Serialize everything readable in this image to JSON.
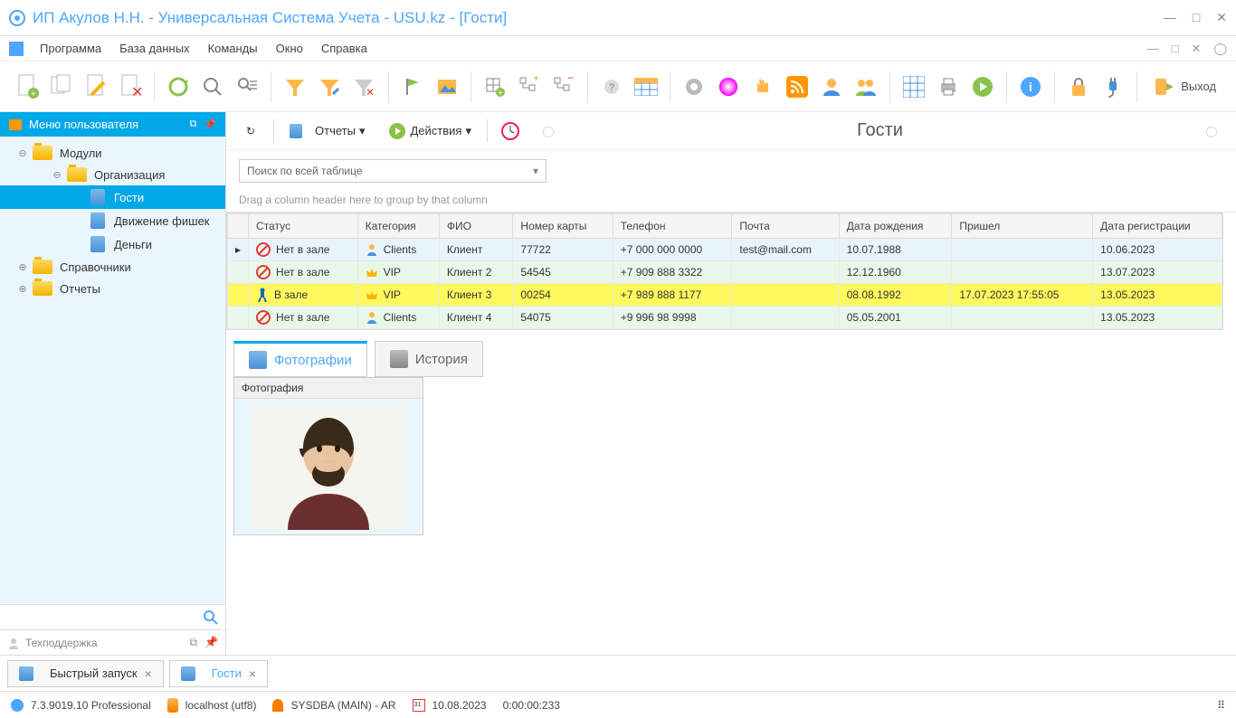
{
  "window": {
    "title": "ИП Акулов Н.Н. - Универсальная Система Учета - USU.kz - [Гости]"
  },
  "menubar": {
    "items": [
      "Программа",
      "База данных",
      "Команды",
      "Окно",
      "Справка"
    ]
  },
  "toolbar": {
    "exit_label": "Выход"
  },
  "sidebar": {
    "header": "Меню пользователя",
    "tree": {
      "modules": "Модули",
      "organization": "Организация",
      "guests": "Гости",
      "chips": "Движение фишек",
      "money": "Деньги",
      "refs": "Справочники",
      "reports": "Отчеты"
    },
    "support": "Техподдержка"
  },
  "content": {
    "reports_btn": "Отчеты",
    "actions_btn": "Действия",
    "title": "Гости",
    "search_placeholder": "Поиск по всей таблице",
    "group_hint": "Drag a column header here to group by that column",
    "columns": [
      "Статус",
      "Категория",
      "ФИО",
      "Номер карты",
      "Телефон",
      "Почта",
      "Дата рождения",
      "Пришел",
      "Дата регистрации"
    ],
    "rows": [
      {
        "status": "Нет в зале",
        "cat_icon": "clients",
        "category": "Clients",
        "fio": "Клиент",
        "card": "77722",
        "phone": "+7 000 000 0000",
        "mail": "test@mail.com",
        "dob": "10.07.1988",
        "came": "",
        "reg": "10.06.2023"
      },
      {
        "status": "Нет в зале",
        "cat_icon": "vip",
        "category": "VIP",
        "fio": "Клиент 2",
        "card": "54545",
        "phone": "+7 909 888 3322",
        "mail": "",
        "dob": "12.12.1960",
        "came": "",
        "reg": "13.07.2023"
      },
      {
        "status": "В зале",
        "cat_icon": "vip",
        "category": "VIP",
        "fio": "Клиент 3",
        "card": "00254",
        "phone": "+7 989 888 1177",
        "mail": "",
        "dob": "08.08.1992",
        "came": "17.07.2023 17:55:05",
        "reg": "13.05.2023"
      },
      {
        "status": "Нет в зале",
        "cat_icon": "clients",
        "category": "Clients",
        "fio": "Клиент 4",
        "card": "54075",
        "phone": "+9 996 98 9998",
        "mail": "",
        "dob": "05.05.2001",
        "came": "",
        "reg": "13.05.2023"
      }
    ],
    "tabs": {
      "photos": "Фотографии",
      "history": "История"
    },
    "photo_header": "Фотография"
  },
  "bottom_tabs": {
    "quick": "Быстрый запуск",
    "guests": "Гости"
  },
  "statusbar": {
    "version": "7.3.9019.10 Professional",
    "host": "localhost (utf8)",
    "user": "SYSDBA (MAIN) - AR",
    "date": "10.08.2023",
    "time": "0:00:00:233"
  }
}
